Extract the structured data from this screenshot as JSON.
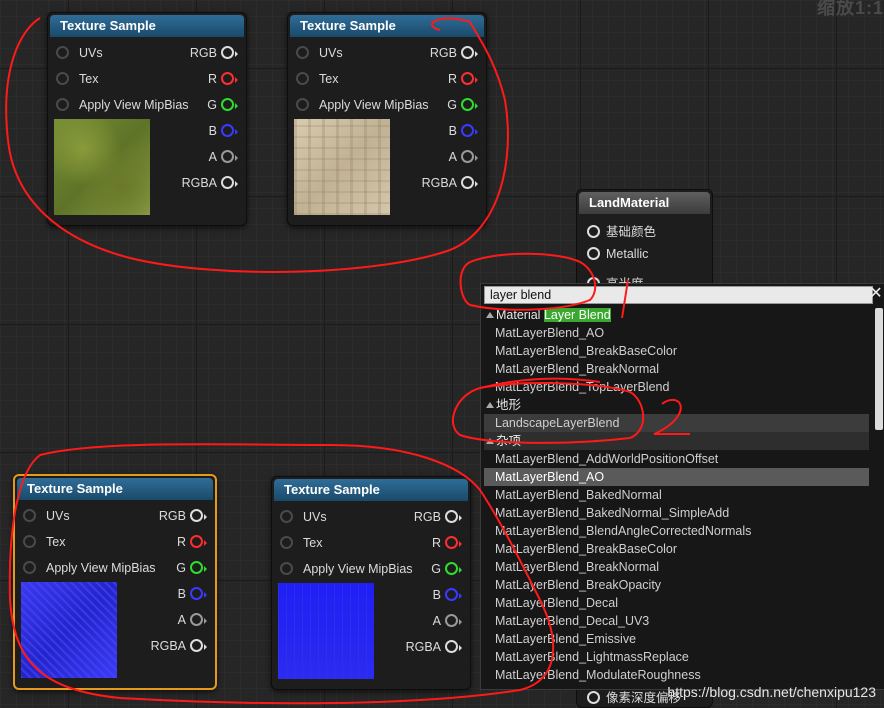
{
  "zoom_label": "缩放1:1",
  "texture_nodes": [
    {
      "title": "Texture Sample",
      "inputs": [
        "UVs",
        "Tex",
        "Apply View MipBias"
      ],
      "outputs": [
        "RGB",
        "R",
        "G",
        "B",
        "A",
        "RGBA"
      ],
      "texture": "grass"
    },
    {
      "title": "Texture Sample",
      "inputs": [
        "UVs",
        "Tex",
        "Apply View MipBias"
      ],
      "outputs": [
        "RGB",
        "R",
        "G",
        "B",
        "A",
        "RGBA"
      ],
      "texture": "stone"
    },
    {
      "title": "Texture Sample",
      "inputs": [
        "UVs",
        "Tex",
        "Apply View MipBias"
      ],
      "outputs": [
        "RGB",
        "R",
        "G",
        "B",
        "A",
        "RGBA"
      ],
      "texture": "normal-blue"
    },
    {
      "title": "Texture Sample",
      "inputs": [
        "UVs",
        "Tex",
        "Apply View MipBias"
      ],
      "outputs": [
        "RGB",
        "R",
        "G",
        "B",
        "A",
        "RGBA"
      ],
      "texture": "normal-blue-flat"
    }
  ],
  "output_pin_colors": {
    "RGB": "#dddddd",
    "R": "#ff2d2d",
    "G": "#2ddf2d",
    "B": "#3a3aff",
    "A": "#9a9a9a",
    "RGBA": "#dddddd"
  },
  "land_material": {
    "title": "LandMaterial",
    "pins": [
      "基础颜色",
      "Metallic",
      "高光度"
    ],
    "bottom_pin": "像素深度偏移"
  },
  "action_menu": {
    "search_value": "layer blend",
    "close_icon": "close-icon",
    "first_category": {
      "prefix": "Material ",
      "highlight": "Layer Blend"
    },
    "items_a": [
      "MatLayerBlend_AO",
      "MatLayerBlend_BreakBaseColor",
      "MatLayerBlend_BreakNormal",
      "MatLayerBlend_TopLayerBlend"
    ],
    "category_terrain": "地形",
    "terrain_item": "LandscapeLayerBlend",
    "category_misc": "杂项",
    "items_b": [
      "MatLayerBlend_AddWorldPositionOffset",
      "MatLayerBlend_AO",
      "MatLayerBlend_BakedNormal",
      "MatLayerBlend_BakedNormal_SimpleAdd",
      "MatLayerBlend_BlendAngleCorrectedNormals",
      "MatLayerBlend_BreakBaseColor",
      "MatLayerBlend_BreakNormal",
      "MatLayerBlend_BreakOpacity",
      "MatLayerBlend_Decal",
      "MatLayerBlend_Decal_UV3",
      "MatLayerBlend_Emissive",
      "MatLayerBlend_LightmassReplace",
      "MatLayerBlend_ModulateRoughness"
    ],
    "selected_item": "MatLayerBlend_AO"
  },
  "watermark": "https://blog.csdn.net/chenxipu123",
  "annotation": {
    "label": "2",
    "stroke_color": "#ff1a1a"
  }
}
